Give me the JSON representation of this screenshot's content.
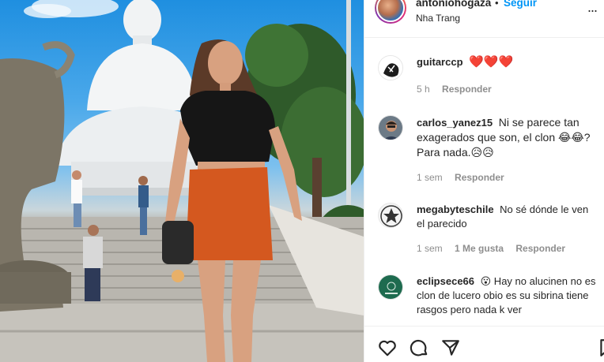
{
  "post": {
    "username": "antoniohogaza",
    "separator": "•",
    "follow_label": "Seguir",
    "location": "Nha Trang",
    "more_label": "...",
    "photo_icon": "photo-of-woman-at-white-buddha-statue"
  },
  "comments": [
    {
      "user": "guitarccp",
      "text": "❤️❤️❤️",
      "time": "5 h",
      "likes": "",
      "reply": "Responder",
      "avatar_icon": "sketch-avatar"
    },
    {
      "user": "carlos_yanez15",
      "text": "Ni se parece tan exagerados que son, el clon 😂😂? Para nada.😥😥",
      "time": "1 sem",
      "likes": "",
      "reply": "Responder",
      "avatar_icon": "man-photo-avatar"
    },
    {
      "user": "megabyteschile",
      "text": "No sé dónde le ven el parecido",
      "time": "1 sem",
      "likes": "1 Me gusta",
      "reply": "Responder",
      "avatar_icon": "star-badge-avatar"
    },
    {
      "user": "eclipsece66",
      "text": "😮 Hay no alucinen no es clon de lucero obio es su sibrina tiene rasgos pero nada k ver",
      "time": "",
      "likes": "",
      "reply": "",
      "avatar_icon": "green-logo-avatar"
    }
  ],
  "actions": [
    "like",
    "comment",
    "share",
    "save"
  ],
  "colors": {
    "link": "#0095f6",
    "heart": "#ed4956",
    "muted": "#8e8e8e",
    "text": "#262626"
  }
}
